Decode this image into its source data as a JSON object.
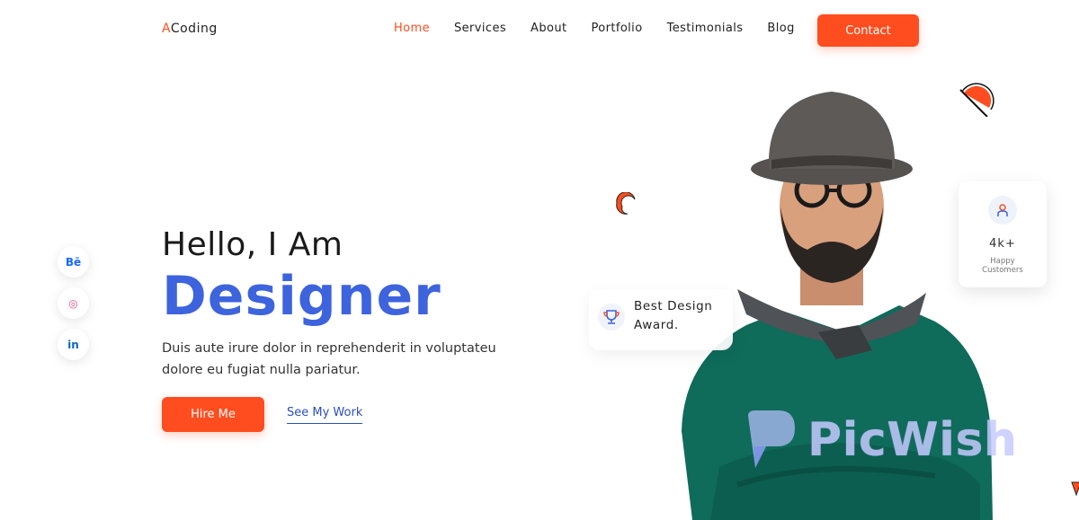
{
  "header": {
    "logo_first": "A",
    "logo_rest": "Coding",
    "nav": [
      "Home",
      "Services",
      "About",
      "Portfolio",
      "Testimonials",
      "Blog"
    ],
    "active_nav": "Home",
    "contact_label": "Contact"
  },
  "socials": [
    {
      "icon": "behance-icon",
      "glyph": "Bē"
    },
    {
      "icon": "dribbble-icon",
      "glyph": "◎"
    },
    {
      "icon": "linkedin-icon",
      "glyph": "in"
    }
  ],
  "hero": {
    "greeting": "Hello, I Am",
    "role": "Designer",
    "description": "Duis aute irure dolor in reprehenderit in voluptateu dolore eu fugiat nulla pariatur.",
    "hire_label": "Hire Me",
    "work_label": "See My Work"
  },
  "award": {
    "line1": "Best Design",
    "line2": "Award.",
    "icon": "trophy-icon"
  },
  "customers": {
    "count": "4k+",
    "label": "Happy Customers",
    "icon": "user-icon"
  },
  "watermark": {
    "text": "PicWish"
  },
  "colors": {
    "accent": "#ff4d1f",
    "primary": "#3d63dd",
    "sweater": "#0f6b5a"
  }
}
